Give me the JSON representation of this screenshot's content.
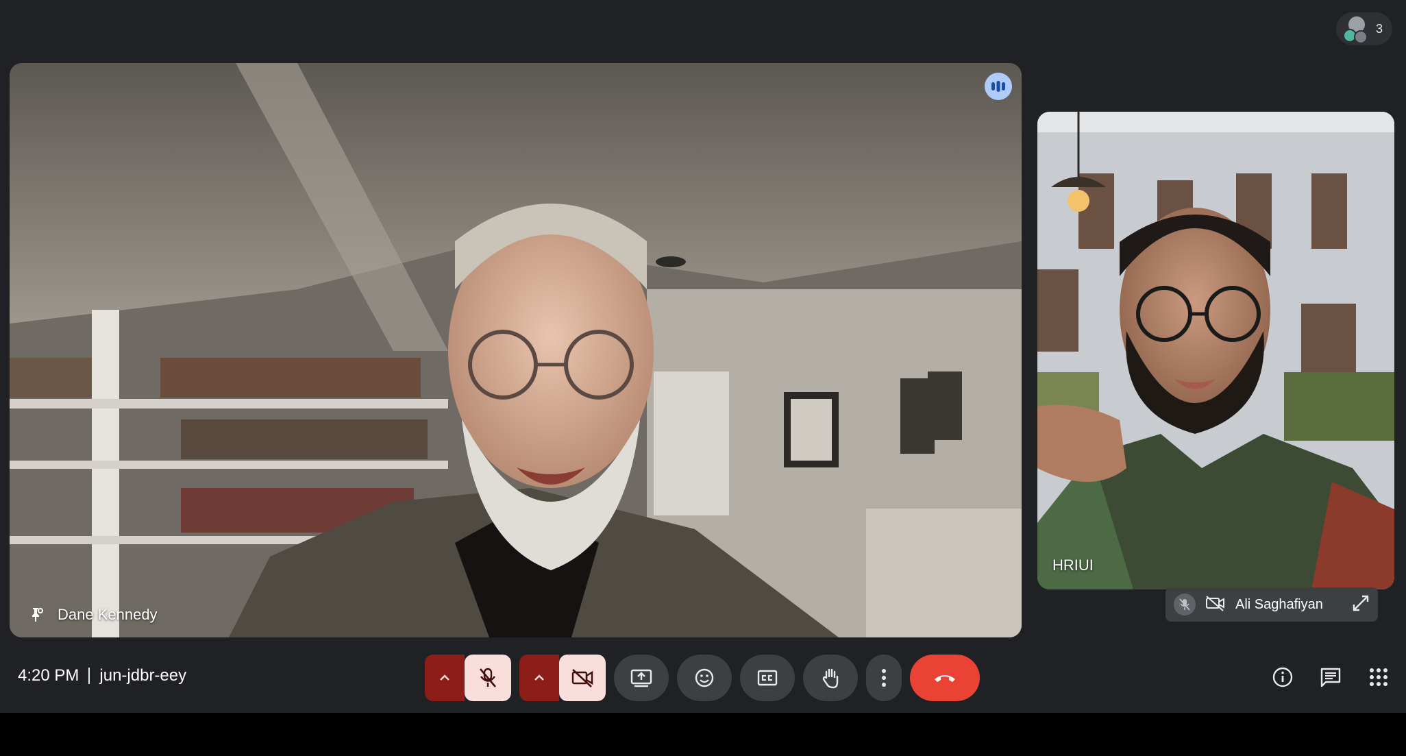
{
  "header": {
    "participant_count": "3",
    "icons": [
      "participants-avatar-icon"
    ]
  },
  "main_tile": {
    "participant_name": "Dane Kennedy",
    "speaking_indicator": "audio-level-icon",
    "pinned_icon": "pin-icon"
  },
  "side_tile": {
    "overlay_text": "HRIUI",
    "self_name": "Ali Saghafiyan",
    "icons": [
      "mic-off-icon",
      "camera-off-icon",
      "expand-icon"
    ]
  },
  "footer": {
    "time": "4:20 PM",
    "meeting_code": "jun-jdbr-eey",
    "controls": [
      {
        "name": "audio-options",
        "icon": "chevron-up-icon"
      },
      {
        "name": "microphone",
        "icon": "mic-off-icon",
        "state": "off"
      },
      {
        "name": "video-options",
        "icon": "chevron-up-icon"
      },
      {
        "name": "camera",
        "icon": "camera-off-icon",
        "state": "off"
      },
      {
        "name": "present",
        "icon": "present-screen-icon"
      },
      {
        "name": "reactions",
        "icon": "emoji-icon"
      },
      {
        "name": "captions",
        "icon": "captions-icon"
      },
      {
        "name": "raise-hand",
        "icon": "hand-icon"
      },
      {
        "name": "more-options",
        "icon": "more-vert-icon"
      },
      {
        "name": "leave-call",
        "icon": "end-call-icon"
      }
    ],
    "right_tools": [
      "info-icon",
      "chat-icon",
      "activities-icon"
    ]
  },
  "colors": {
    "stage_bg": "#202124",
    "control_bg": "#3c4043",
    "off_state_bg": "#f9dedc",
    "off_caret_bg": "#8c1d18",
    "end_call": "#ea4335",
    "speaking": "#aecbfa"
  }
}
